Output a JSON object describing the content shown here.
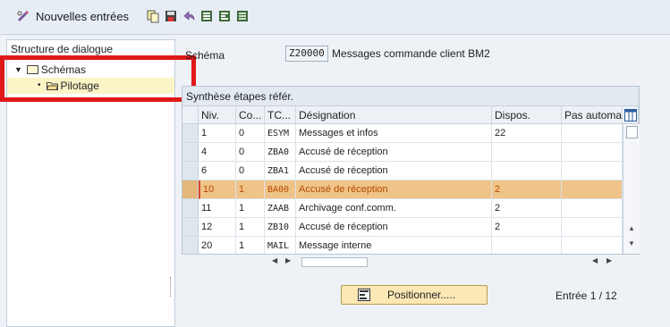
{
  "toolbar": {
    "new_entries_label": "Nouvelles entrées",
    "icons": [
      "pen-glasses-icon",
      "copy-icon",
      "save-icon",
      "undo-icon",
      "select-all-icon",
      "select-block-icon",
      "deselect-icon"
    ]
  },
  "left_panel": {
    "title": "Structure de dialogue",
    "tree": [
      {
        "label": "Schémas",
        "level": 0,
        "expanded": true
      },
      {
        "label": "Pilotage",
        "level": 1,
        "selected": true
      }
    ]
  },
  "header": {
    "schema_label": "Schéma",
    "schema_code": "Z20000",
    "schema_desc": "Messages commande client BM2"
  },
  "table": {
    "title": "Synthèse étapes référ.",
    "columns": [
      "Niv.",
      "Co...",
      "TC...",
      "Désignation",
      "Dispos.",
      "Pas automa"
    ],
    "rows": [
      {
        "niv": "1",
        "co": "0",
        "tc": "ESYM",
        "designation": "Messages et infos",
        "dispos": "22",
        "highlight": false
      },
      {
        "niv": "4",
        "co": "0",
        "tc": "ZBA0",
        "designation": "Accusé de réception",
        "dispos": "",
        "highlight": false
      },
      {
        "niv": "6",
        "co": "0",
        "tc": "ZBA1",
        "designation": "Accusé de réception",
        "dispos": "",
        "highlight": false
      },
      {
        "niv": "10",
        "co": "1",
        "tc": "BA00",
        "designation": "Accusé de réception",
        "dispos": "2",
        "highlight": true
      },
      {
        "niv": "11",
        "co": "1",
        "tc": "ZAAB",
        "designation": "Archivage conf.comm.",
        "dispos": "2",
        "highlight": false
      },
      {
        "niv": "12",
        "co": "1",
        "tc": "ZB10",
        "designation": "Accusé de réception",
        "dispos": "2",
        "highlight": false
      },
      {
        "niv": "20",
        "co": "1",
        "tc": "MAIL",
        "designation": "Message interne",
        "dispos": "",
        "highlight": false
      }
    ]
  },
  "footer": {
    "position_button": "Positionner.....",
    "entry_text": "Entrée 1 / 12"
  }
}
